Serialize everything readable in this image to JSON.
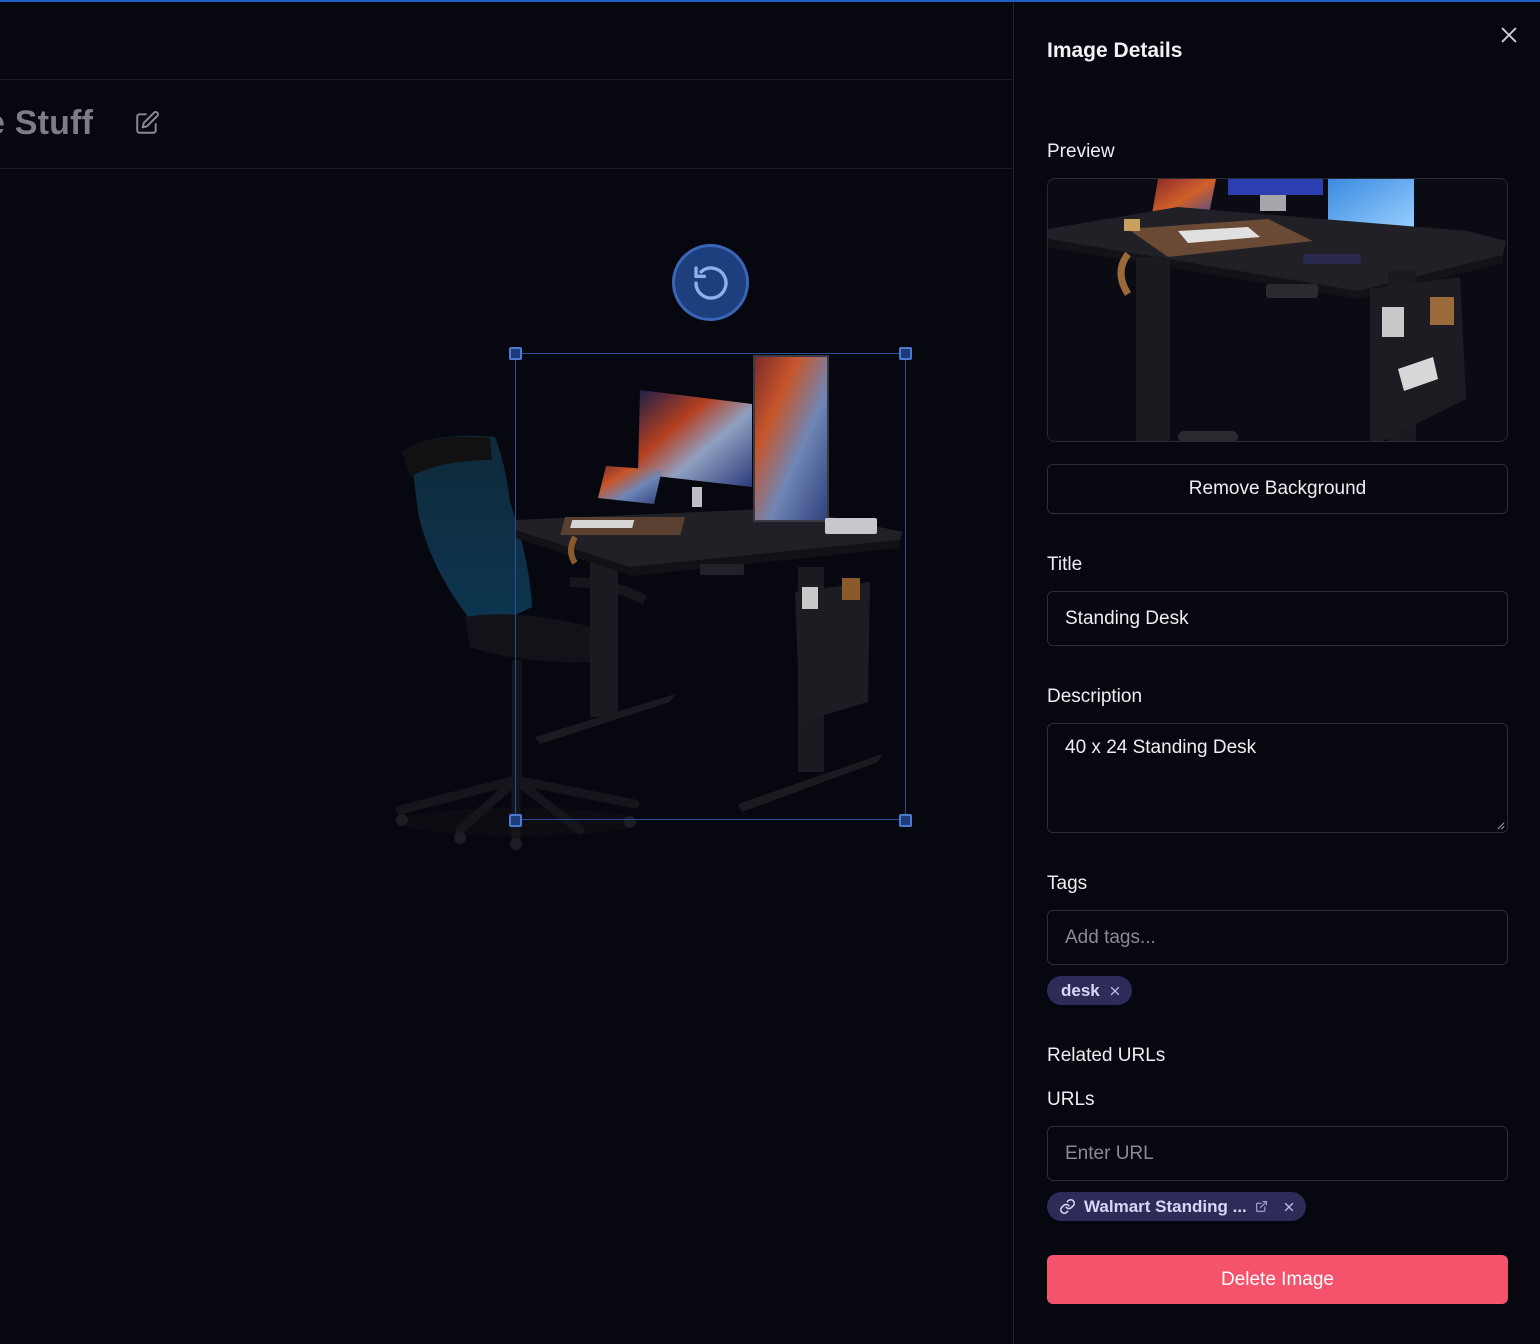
{
  "board": {
    "title": "e Stuff"
  },
  "panel": {
    "title": "Image Details",
    "preview_label": "Preview",
    "remove_bg_label": "Remove Background",
    "title_label": "Title",
    "title_value": "Standing Desk",
    "description_label": "Description",
    "description_value": "40 x 24 Standing Desk",
    "tags_label": "Tags",
    "tags_placeholder": "Add tags...",
    "tags": [
      "desk"
    ],
    "related_urls_label": "Related URLs",
    "urls_label": "URLs",
    "url_placeholder": "Enter URL",
    "urls": [
      "Walmart Standing ..."
    ],
    "delete_label": "Delete Image"
  },
  "icons": {
    "close": "close-icon",
    "edit": "edit-icon",
    "rotate": "rotate-icon",
    "link": "link-icon",
    "external": "external-link-icon"
  },
  "colors": {
    "accent": "#1f5fc4",
    "danger": "#f5526c",
    "chip_bg": "#2d2c59",
    "background": "#07070f"
  }
}
